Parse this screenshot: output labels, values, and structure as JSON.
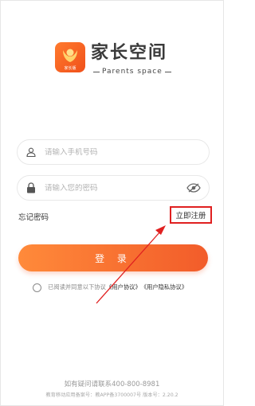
{
  "brand": {
    "title": "家长空间",
    "subtitle": "Parents  space",
    "logo_caption": "家长版"
  },
  "form": {
    "phone_placeholder": "请输入手机号码",
    "password_placeholder": "请输入您的密码",
    "forgot_label": "忘记密码",
    "register_label": "立即注册",
    "login_label": "登 录"
  },
  "agreement": {
    "prefix": "已阅读并同意以下协议",
    "user_agreement": "《用户协议》",
    "privacy_agreement": "《用户隐私协议》"
  },
  "footer": {
    "contact": "如有疑问请联系400-800-8981",
    "icp": "教育移动应用备案号：教APP备3700007号 版本号：2.20.2"
  },
  "colors": {
    "accent": "#f25c2a",
    "annotation": "#e02020"
  }
}
